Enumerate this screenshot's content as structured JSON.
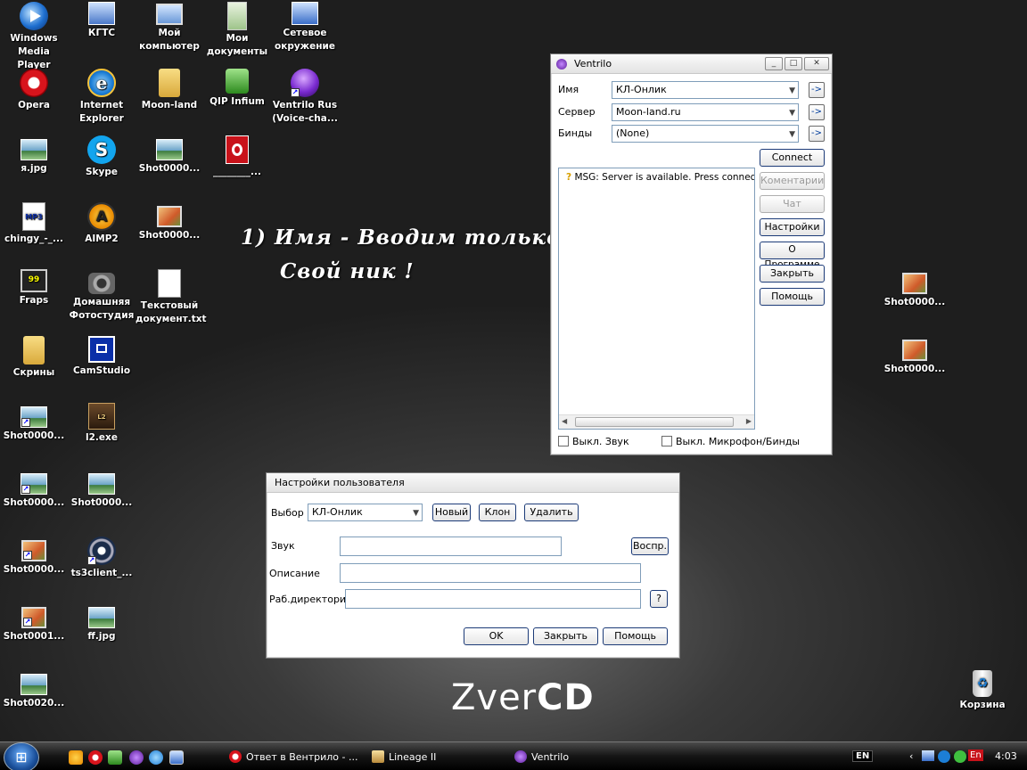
{
  "desktop_icons": [
    {
      "label": "Windows Media Player",
      "icon": "media-player-icon"
    },
    {
      "label": "КГТС",
      "icon": "network-computer-icon"
    },
    {
      "label": "Мой компьютер",
      "icon": "my-computer-icon"
    },
    {
      "label": "Мои документы",
      "icon": "my-documents-icon"
    },
    {
      "label": "Сетевое окружение",
      "icon": "network-places-icon"
    },
    {
      "label": "Opera",
      "icon": "opera-icon"
    },
    {
      "label": "Internet Explorer",
      "icon": "internet-explorer-icon"
    },
    {
      "label": "Moon-land",
      "icon": "folder-icon"
    },
    {
      "label": "QIP Infium",
      "icon": "qip-icon"
    },
    {
      "label": "Ventrilo Rus (Voice-cha...",
      "icon": "ventrilo-icon"
    },
    {
      "label": "я.jpg",
      "icon": "image-file-icon"
    },
    {
      "label": "Skype",
      "icon": "skype-icon"
    },
    {
      "label": "Shot0000...",
      "icon": "screenshot-file-icon"
    },
    {
      "label": "________...",
      "icon": "opera-file-icon"
    },
    {
      "label": "chingy_-_...",
      "icon": "mp3-file-icon"
    },
    {
      "label": "AIMP2",
      "icon": "aimp-icon"
    },
    {
      "label": "Shot0000...",
      "icon": "screenshot-file-icon"
    },
    {
      "label": "Fraps",
      "icon": "fraps-icon"
    },
    {
      "label": "Домашняя Фотостудия",
      "icon": "camera-icon"
    },
    {
      "label": "Текстовый документ.txt",
      "icon": "text-document-icon"
    },
    {
      "label": "Скрины",
      "icon": "folder-icon"
    },
    {
      "label": "CamStudio",
      "icon": "camstudio-icon"
    },
    {
      "label": "Shot0000...",
      "icon": "image-file-icon"
    },
    {
      "label": "l2.exe",
      "icon": "lineage-icon"
    },
    {
      "label": "Shot0000...",
      "icon": "image-file-icon"
    },
    {
      "label": "Shot0000...",
      "icon": "image-file-icon"
    },
    {
      "label": "Shot0000...",
      "icon": "screenshot-file-icon"
    },
    {
      "label": "ts3client_...",
      "icon": "teamspeak-icon"
    },
    {
      "label": "Shot0001...",
      "icon": "screenshot-file-icon"
    },
    {
      "label": "ff.jpg",
      "icon": "image-file-icon"
    },
    {
      "label": "Shot0020...",
      "icon": "image-file-icon"
    },
    {
      "label": "Shot0000...",
      "icon": "screenshot-file-icon"
    },
    {
      "label": "Shot0000...",
      "icon": "screenshot-file-icon"
    },
    {
      "label": "Корзина",
      "icon": "recycle-bin-icon"
    }
  ],
  "overlay": {
    "line1": "1) Имя - Вводим только",
    "line2": "Свой ник !"
  },
  "brand": {
    "light": "Zver",
    "bold": "CD"
  },
  "ventrilo": {
    "title": "Ventrilo",
    "name_label": "Имя",
    "name_value": "КЛ-Онлик",
    "server_label": "Сервер",
    "server_value": "Moon-land.ru",
    "binds_label": "Бинды",
    "binds_value": "(None)",
    "arrow": "->",
    "buttons": {
      "connect": "Connect",
      "comments": "Коментарии",
      "chat": "Чат",
      "settings": "Настройки",
      "about": "О Программе",
      "close": "Закрыть",
      "help": "Помощь"
    },
    "message": "MSG: Server is available. Press connect.",
    "mute_sound": "Выкл. Звук",
    "mute_mic": "Выкл. Микрофон/Бинды"
  },
  "user_settings": {
    "title": "Настройки пользователя",
    "choose_label": "Выбор",
    "choose_value": "КЛ-Онлик",
    "new_btn": "Новый",
    "clone_btn": "Клон",
    "delete_btn": "Удалить",
    "sound_label": "Звук",
    "play_btn": "Воспр.",
    "description_label": "Описание",
    "workdir_label": "Раб.директория",
    "browse_btn": "?",
    "ok_btn": "OK",
    "close_btn": "Закрыть",
    "help_btn": "Помощь"
  },
  "taskbar": {
    "tasks": [
      "Ответ в Вентрило - ...",
      "Lineage II",
      "Ventrilo"
    ],
    "lang": "EN",
    "tray_lang": "En",
    "clock": "4:03"
  }
}
